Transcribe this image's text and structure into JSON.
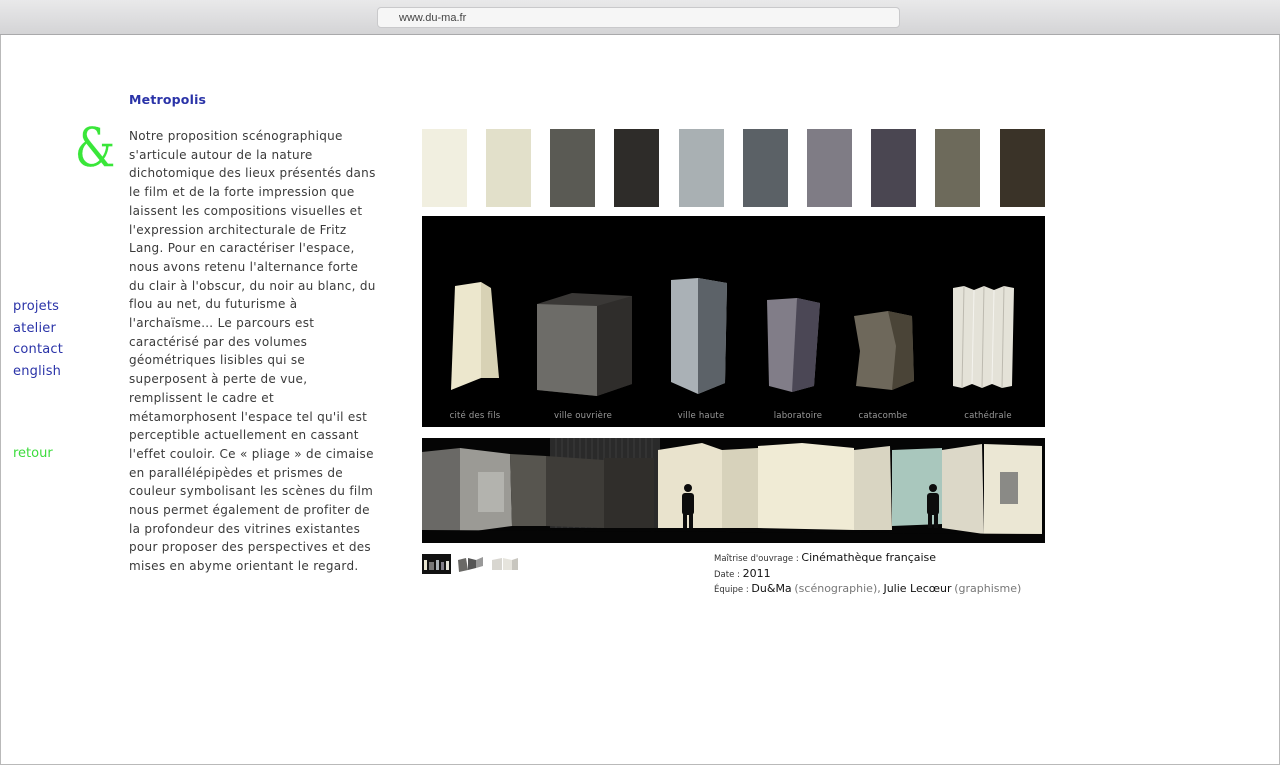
{
  "browser": {
    "url": "www.du-ma.fr"
  },
  "logo": {
    "glyph": "&"
  },
  "nav": {
    "items": [
      "projets",
      "atelier",
      "contact",
      "english"
    ],
    "back": "retour"
  },
  "project": {
    "title": "Metropolis",
    "description": "Notre proposition scénographique s'articule autour de la nature dichotomique des lieux présentés dans le film et de la forte impression que laissent les compositions visuelles et l'expression architecturale de Fritz Lang. Pour en caractériser l'espace, nous avons retenu l'alternance forte du clair à l'obscur, du noir au blanc, du flou au net, du futurisme à l'archaïsme… Le parcours est caractérisé par des volumes géométriques lisibles qui se superposent à perte de vue, remplissent le cadre et métamorphosent l'espace tel qu'il est perceptible actuellement en cassant l'effet couloir. Ce « pliage » de cimaise en parallélépipèdes et prismes de couleur  symbolisant les scènes du film nous permet également de profiter de la profondeur des vitrines existantes pour proposer des perspectives et des mises en abyme orientant le regard."
  },
  "palette": [
    "#f1efe0",
    "#e2e0ca",
    "#5a5a54",
    "#2e2c29",
    "#a9b0b3",
    "#5b6166",
    "#7f7c85",
    "#4a4651",
    "#6d6a5b",
    "#3a3328"
  ],
  "volumes": {
    "labels": [
      "cité des fils",
      "ville ouvrière",
      "ville haute",
      "laboratoire",
      "catacombe",
      "cathédrale"
    ]
  },
  "credits": {
    "client_label": "Maîtrise d'ouvrage :",
    "client": "Cinémathèque française",
    "date_label": "Date :",
    "date": "2011",
    "team_label": "Équipe :",
    "team_1": "Du&Ma",
    "team_1_role": "(scénographie),",
    "team_2": "Julie Lecœur",
    "team_2_role": "(graphisme)"
  }
}
